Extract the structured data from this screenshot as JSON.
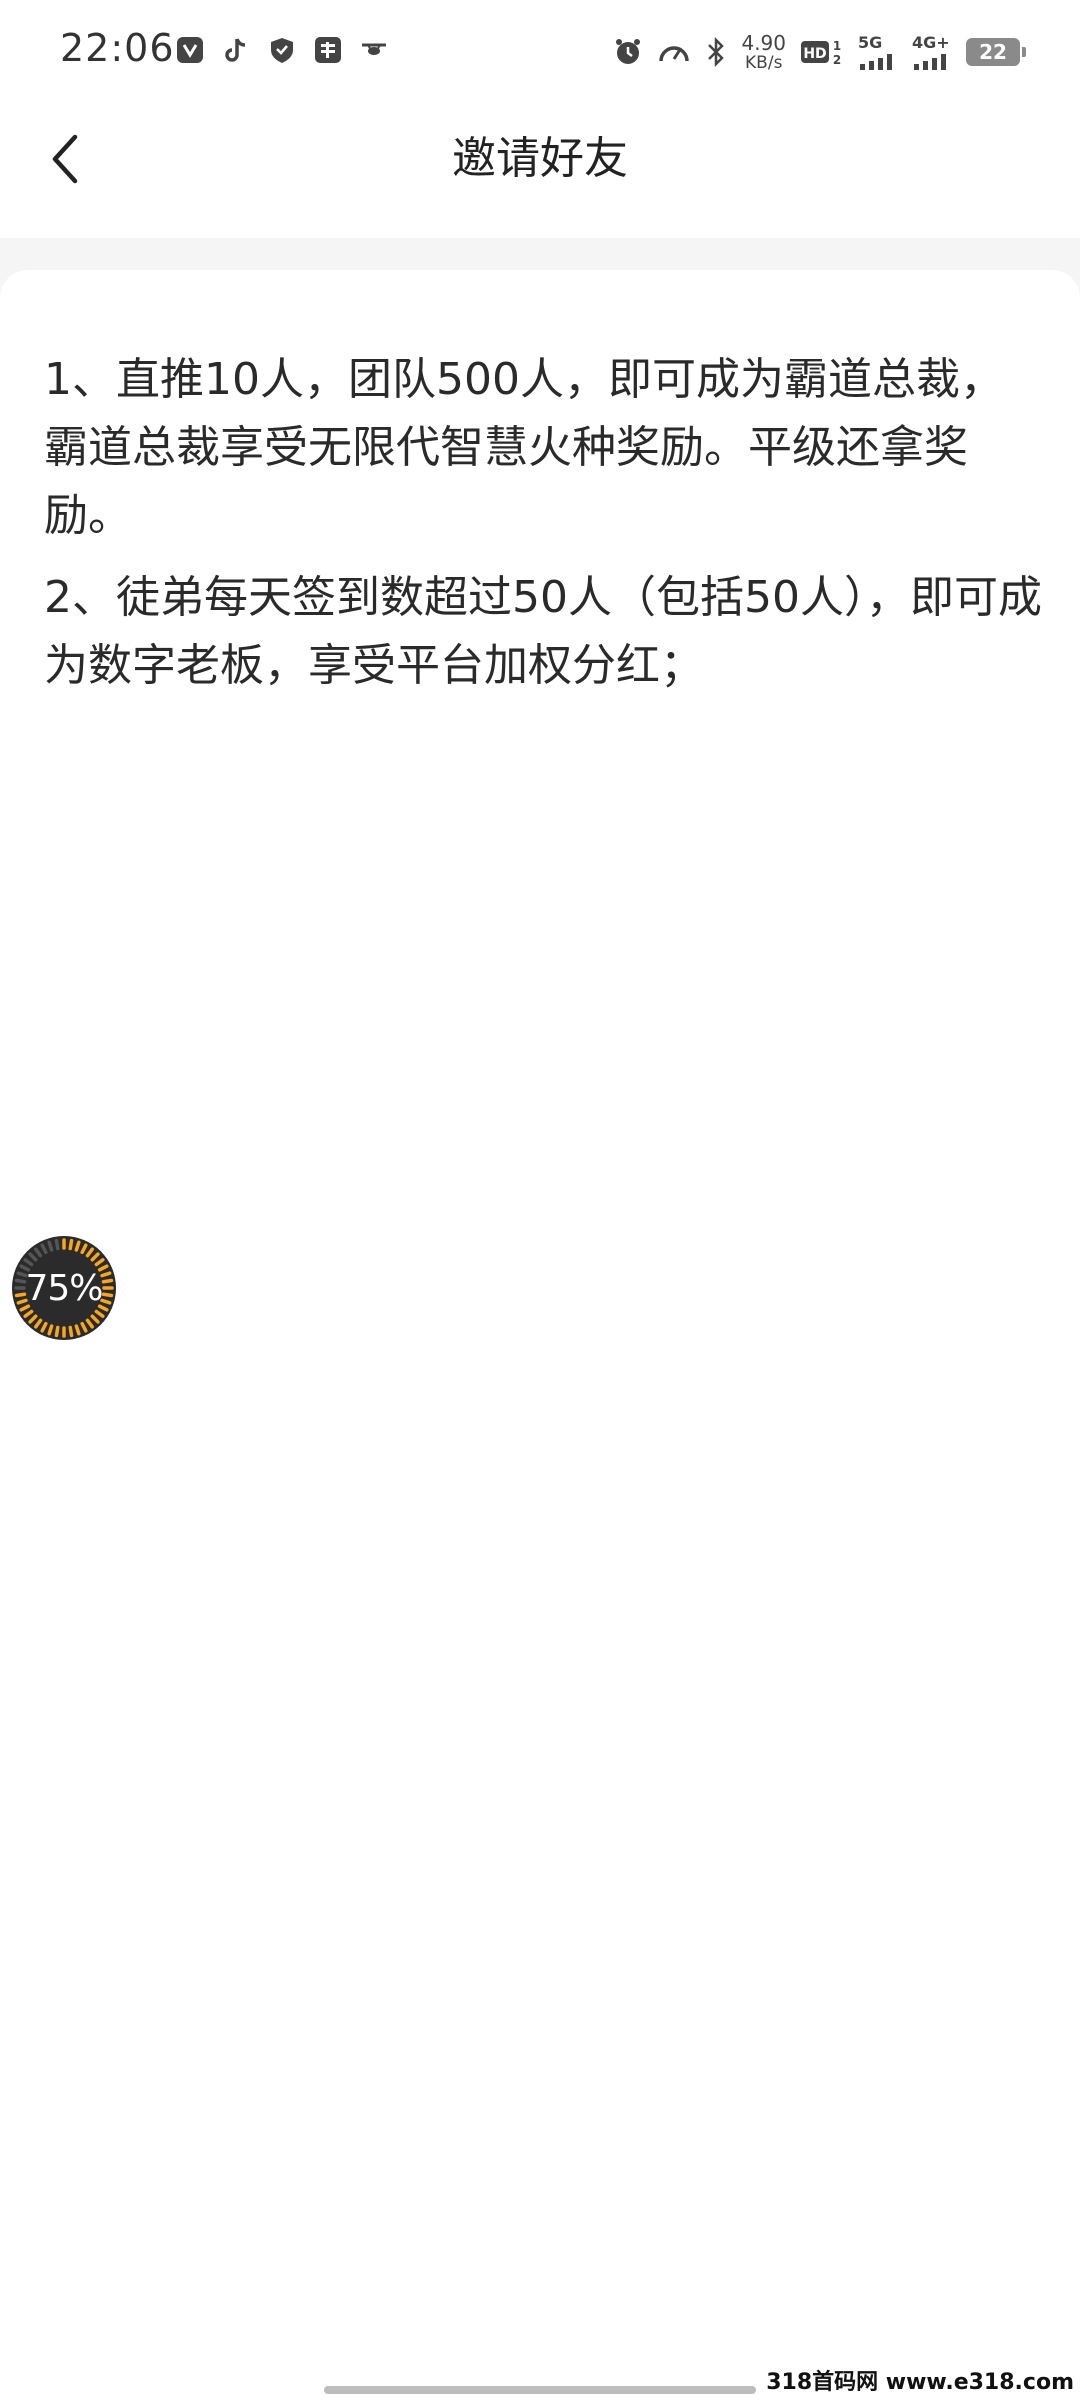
{
  "status_bar": {
    "time": "22:06",
    "app_icons": [
      "shield-app-icon",
      "tiktok-icon",
      "vpn-shield-icon",
      "taobao-icon",
      "drone-icon"
    ],
    "net_speed_value": "4.90",
    "net_speed_unit": "KB/s",
    "hd_label": "HD",
    "sim1_label": "5G",
    "sim2_label": "4G+",
    "battery_level": "22"
  },
  "header": {
    "title": "邀请好友"
  },
  "rules": [
    "1、直推10人，团队500人，即可成为霸道总裁，霸道总裁享受无限代智慧火种奖励。平级还拿奖励。",
    "2、徒弟每天签到数超过50人（包括50人），即可成为数字老板，享受平台加权分红；"
  ],
  "floating_badge": {
    "label": "75%",
    "progress": 0.75,
    "ring_color": "#f5a623",
    "bg_color": "#2b2b2b"
  },
  "watermark": "318首码网 www.e318.com"
}
